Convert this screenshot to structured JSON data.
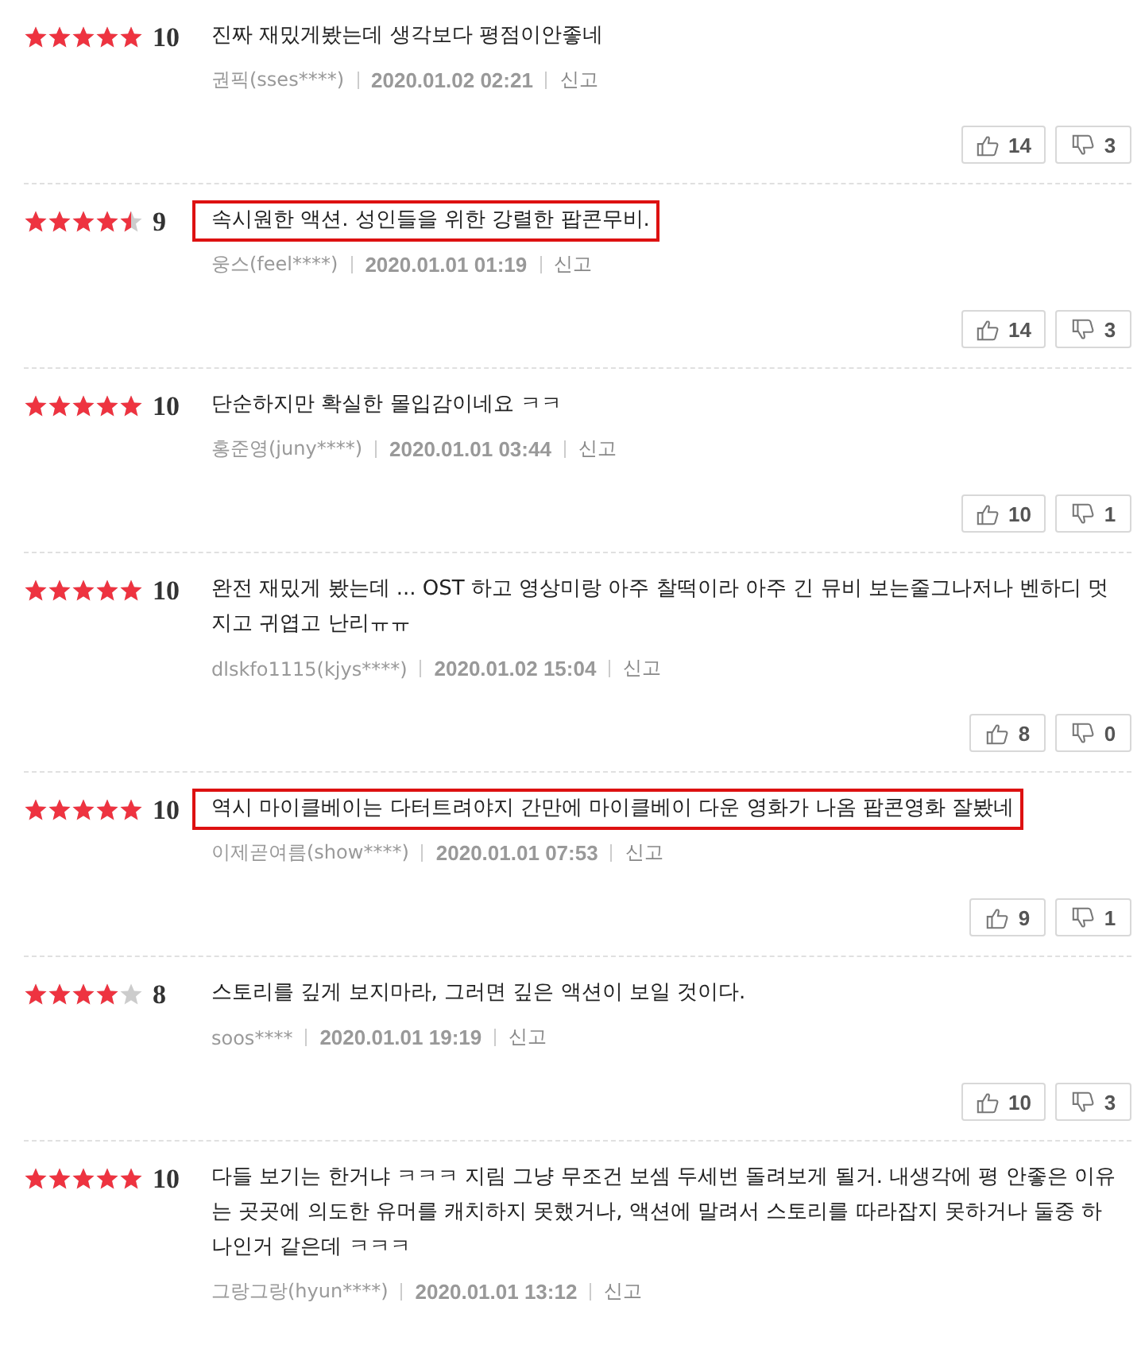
{
  "reviews": [
    {
      "stars": 5,
      "score": "10",
      "text": "진짜 재밌게봤는데 생각보다 평점이안좋네",
      "highlighted": false,
      "author": "권픽(sses****)",
      "date": "2020.01.02 02:21",
      "report": "신고",
      "likes": "14",
      "dislikes": "3"
    },
    {
      "stars": 4.5,
      "score": "9",
      "text": "속시원한 액션. 성인들을 위한 강렬한 팝콘무비.",
      "highlighted": true,
      "author": "웅스(feel****)",
      "date": "2020.01.01 01:19",
      "report": "신고",
      "likes": "14",
      "dislikes": "3"
    },
    {
      "stars": 5,
      "score": "10",
      "text": "단순하지만 확실한 몰입감이네요 ㅋㅋ",
      "highlighted": false,
      "author": "홍준영(juny****)",
      "date": "2020.01.01 03:44",
      "report": "신고",
      "likes": "10",
      "dislikes": "1"
    },
    {
      "stars": 5,
      "score": "10",
      "text": "완전 재밌게 봤는데 ... OST 하고 영상미랑 아주 찰떡이라 아주 긴 뮤비 보는줄그나저나 벤하디 멋지고 귀엽고 난리ㅠㅠ",
      "highlighted": false,
      "author": "dlskfo1115(kjys****)",
      "date": "2020.01.02 15:04",
      "report": "신고",
      "likes": "8",
      "dislikes": "0"
    },
    {
      "stars": 5,
      "score": "10",
      "text": "역시 마이클베이는 다터트려야지 간만에 마이클베이 다운 영화가 나옴 팝콘영화 잘봤네",
      "highlighted": true,
      "author": "이제곧여름(show****)",
      "date": "2020.01.01 07:53",
      "report": "신고",
      "likes": "9",
      "dislikes": "1"
    },
    {
      "stars": 4,
      "score": "8",
      "text": "스토리를 깊게 보지마라, 그러면 깊은 액션이 보일 것이다.",
      "highlighted": false,
      "author": "soos****",
      "date": "2020.01.01 19:19",
      "report": "신고",
      "likes": "10",
      "dislikes": "3"
    },
    {
      "stars": 5,
      "score": "10",
      "text": "다들 보기는 한거냐 ㅋㅋㅋ 지림 그냥 무조건 보셈 두세번 돌려보게 될거. 내생각에 평 안좋은 이유는 곳곳에 의도한 유머를 캐치하지 못했거나, 액션에 말려서 스토리를 따라잡지 못하거나 둘중 하나인거 같은데 ㅋㅋㅋ",
      "highlighted": false,
      "author": "그랑그랑(hyun****)",
      "date": "2020.01.01 13:12",
      "report": "신고"
    }
  ]
}
